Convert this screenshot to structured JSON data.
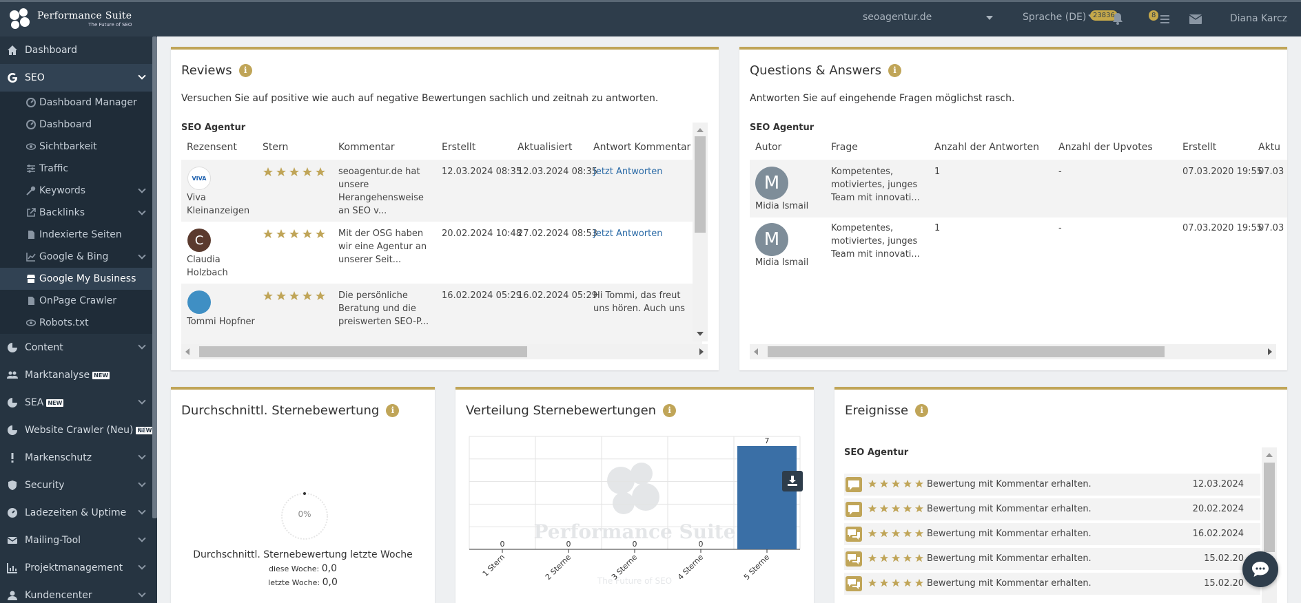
{
  "brand": {
    "title": "Performance Suite",
    "subtitle": "The Future of SEO"
  },
  "topbar": {
    "domain_select": "seoagentur.de",
    "language": "Sprache (DE)",
    "badge_count": "23836",
    "notif_count": "8",
    "user": "Diana Karcz"
  },
  "sidebar": {
    "items": [
      {
        "label": "Dashboard",
        "icon": "home-icon"
      },
      {
        "label": "SEO",
        "icon": "google-icon",
        "active": true
      },
      {
        "label": "Content",
        "icon": "pie-icon"
      },
      {
        "label": "Marktanalyse",
        "icon": "users-icon",
        "badge": "NEW"
      },
      {
        "label": "SEA",
        "icon": "pie-icon",
        "badge": "NEW"
      },
      {
        "label": "Website Crawler (Neu)",
        "icon": "pie-icon",
        "badge": "NEW"
      },
      {
        "label": "Markenschutz",
        "icon": "exclamation-icon"
      },
      {
        "label": "Security",
        "icon": "shield-icon"
      },
      {
        "label": "Ladezeiten & Uptime",
        "icon": "gauge-icon"
      },
      {
        "label": "Mailing-Tool",
        "icon": "mail-icon"
      },
      {
        "label": "Projektmanagement",
        "icon": "chart-icon"
      },
      {
        "label": "Kundencenter",
        "icon": "user-icon"
      }
    ],
    "seo_sub": [
      {
        "label": "Dashboard Manager",
        "icon": "gauge-icon"
      },
      {
        "label": "Dashboard",
        "icon": "gauge-icon"
      },
      {
        "label": "Sichtbarkeit",
        "icon": "eye-icon"
      },
      {
        "label": "Traffic",
        "icon": "sliders-icon"
      },
      {
        "label": "Keywords",
        "icon": "key-icon",
        "expandable": true
      },
      {
        "label": "Backlinks",
        "icon": "external-link-icon",
        "expandable": true
      },
      {
        "label": "Indexierte Seiten",
        "icon": "file-icon"
      },
      {
        "label": "Google & Bing",
        "icon": "chart-icon",
        "expandable": true
      },
      {
        "label": "Google My Business",
        "icon": "store-icon",
        "current": true
      },
      {
        "label": "OnPage Crawler",
        "icon": "file-icon"
      },
      {
        "label": "Robots.txt",
        "icon": "eye-icon"
      }
    ]
  },
  "reviews": {
    "title": "Reviews",
    "description": "Versuchen Sie auf positive wie auch auf negative Bewertungen sachlich und zeitnah zu antworten.",
    "section": "SEO Agentur",
    "columns": [
      "Rezensent",
      "Stern",
      "Kommentar",
      "Erstellt",
      "Aktualisiert",
      "Antwort Kommentar"
    ],
    "rows": [
      {
        "reviewer": "Viva Kleinanzeigen",
        "stars": 5,
        "comment": "seoagentur.de hat unsere Herangehensweise an SEO v...",
        "created": "12.03.2024 08:35",
        "updated": "12.03.2024 08:35",
        "answer": "Jetzt Antworten",
        "answer_link": true,
        "avatar_letter": "VIVA",
        "avatar_color": "#ffffff"
      },
      {
        "reviewer": "Claudia Holzbach",
        "stars": 5,
        "comment": "Mit der OSG haben wir eine Agentur an unserer Seit...",
        "created": "20.02.2024 10:48",
        "updated": "27.02.2024 08:53",
        "answer": "Jetzt Antworten",
        "answer_link": true,
        "avatar_letter": "C",
        "avatar_color": "#5b3a2e"
      },
      {
        "reviewer": "Tommi Hopfner",
        "stars": 5,
        "comment": "Die persönliche Beratung und die preiswerten SEO-P...",
        "created": "16.02.2024 05:29",
        "updated": "16.02.2024 05:29",
        "answer": "Hi Tommi, das freut uns hören. Auch uns macht d",
        "answer_link": false,
        "avatar_letter": "",
        "avatar_color": "#3f8fc4"
      }
    ]
  },
  "qa": {
    "title": "Questions & Answers",
    "description": "Antworten Sie auf eingehende Fragen möglichst rasch.",
    "section": "SEO Agentur",
    "columns": [
      "Autor",
      "Frage",
      "Anzahl der Antworten",
      "Anzahl der Upvotes",
      "Erstellt",
      "Aktu"
    ],
    "rows": [
      {
        "author": "Midia Ismail",
        "question": "Kompetentes, motiviertes, junges Team mit innovati...",
        "answers": "1",
        "upvotes": "-",
        "created": "07.03.2020 19:55",
        "updated": "07.03",
        "avatar_letter": "M"
      },
      {
        "author": "Midia Ismail",
        "question": "Kompetentes, motiviertes, junges Team mit innovati...",
        "answers": "1",
        "upvotes": "-",
        "created": "07.03.2020 19:55",
        "updated": "07.03",
        "avatar_letter": "M"
      }
    ]
  },
  "avg_rating": {
    "title": "Durchschnittl. Sternebewertung",
    "gauge_value": "0%",
    "caption": "Durchschnittl. Sternebewertung letzte Woche",
    "this_week_label": "diese Woche:",
    "this_week_value": "0,0",
    "last_week_label": "letzte Woche:",
    "last_week_value": "0,0"
  },
  "distribution": {
    "title": "Verteilung Sternebewertungen",
    "watermark_title": "Performance Suite",
    "watermark_sub": "The Future of SEO",
    "bar_color": "#3a6fa6"
  },
  "chart_data": {
    "type": "bar",
    "categories": [
      "1 Stern",
      "2 Sterne",
      "3 Sterne",
      "4 Sterne",
      "5 Sterne"
    ],
    "values": [
      0,
      0,
      0,
      0,
      7
    ],
    "ylim": [
      0,
      7
    ]
  },
  "events": {
    "title": "Ereignisse",
    "section": "SEO Agentur",
    "rows": [
      {
        "text": "Bewertung mit Kommentar erhalten.",
        "date": "12.03.2024"
      },
      {
        "text": "Bewertung mit Kommentar erhalten.",
        "date": "20.02.2024"
      },
      {
        "text": "Bewertung mit Kommentar erhalten.",
        "date": "16.02.2024"
      },
      {
        "text": "Bewertung mit Kommentar erhalten.",
        "date": "15.02.20"
      },
      {
        "text": "Bewertung mit Kommentar erhalten.",
        "date": "15.02.20"
      }
    ]
  },
  "colors": {
    "accent": "#c0a558",
    "sidebar": "#263441",
    "topbar": "#2e3d4b"
  }
}
